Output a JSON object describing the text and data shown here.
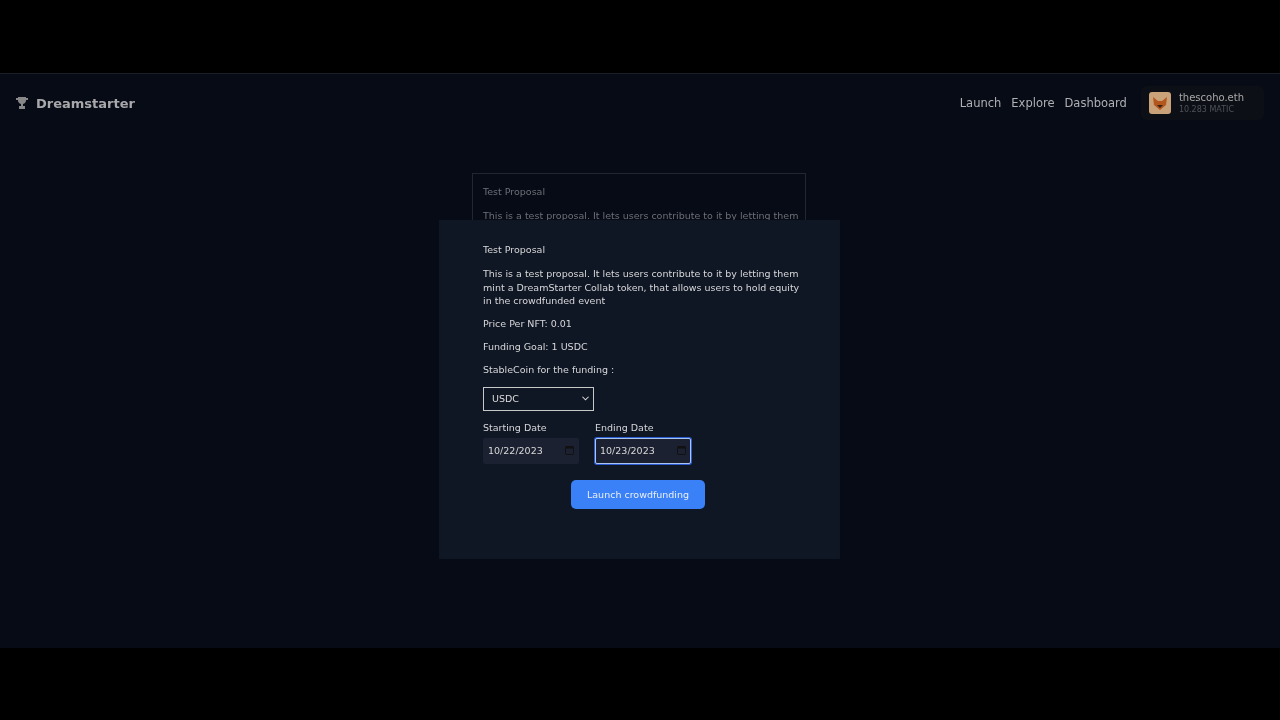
{
  "header": {
    "brand": "Dreamstarter",
    "nav": [
      "Launch",
      "Explore",
      "Dashboard"
    ],
    "wallet": {
      "name": "thescoho.eth",
      "balance": "10.283 MATIC"
    }
  },
  "background_card": {
    "title": "Test Proposal",
    "description": "This is a test proposal. It lets users contribute to it by letting them"
  },
  "modal": {
    "title": "Test Proposal",
    "description": "This is a test proposal. It lets users contribute to it by letting them mint a DreamStarter Collab token, that allows users to hold equity in the crowdfunded event",
    "price": "Price Per NFT: 0.01",
    "goal": "Funding Goal: 1 USDC",
    "stablecoin_label": "StableCoin for the funding :",
    "stablecoin_value": "USDC",
    "dates": [
      {
        "label": "Starting Date",
        "value": "10/22/2023",
        "focused": false
      },
      {
        "label": "Ending Date",
        "value": "10/23/2023",
        "focused": true
      }
    ],
    "button": "Launch crowdfunding"
  }
}
